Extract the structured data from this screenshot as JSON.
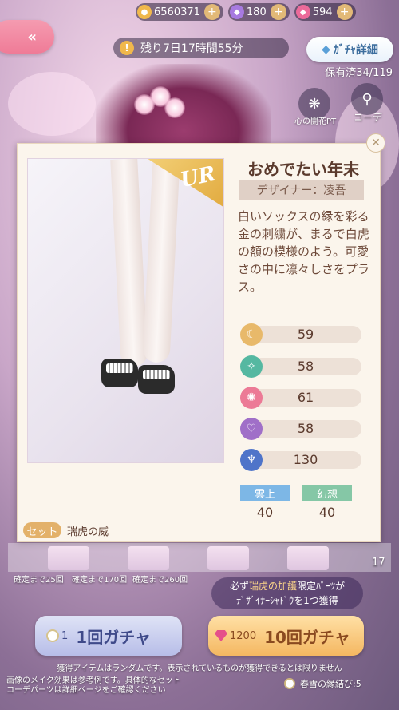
{
  "currencies": [
    {
      "name": "coin-icon",
      "value": "6560371"
    },
    {
      "name": "diamond-icon",
      "value": "180"
    },
    {
      "name": "pink-gem-icon",
      "value": "594"
    }
  ],
  "banner": {
    "timer": "残り7日17時間55分",
    "detail_label": "ｶﾞﾁｬ詳細",
    "owned": "保有済34/119",
    "flower_label": "心の開花PT",
    "coord_label": "コーデ"
  },
  "item": {
    "rarity": "UR",
    "title": "おめでたい年末",
    "designer": "デザイナー：凌吾",
    "description": "白いソックスの縁を彩る金の刺繍が、まるで白虎の額の模様のよう。可愛さの中に凛々しさをプラス。",
    "stats": [
      {
        "icon": "elegant-icon",
        "value": "59",
        "color": "#e8b96a"
      },
      {
        "icon": "fresh-icon",
        "value": "58",
        "color": "#55b8a1"
      },
      {
        "icon": "sweet-icon",
        "value": "61",
        "color": "#ec7a96"
      },
      {
        "icon": "sexy-icon",
        "value": "58",
        "color": "#a06fc8"
      },
      {
        "icon": "cool-icon",
        "value": "130",
        "color": "#4f74c9"
      }
    ],
    "tags": [
      {
        "label": "雲上",
        "value": "40",
        "color": "#7db7e6"
      },
      {
        "label": "幻想",
        "value": "40",
        "color": "#85c7a6"
      }
    ],
    "set_label": "セット",
    "set_name": "瑞虎の威"
  },
  "progress": {
    "counts": [
      "確定まで25回",
      "確定まで170回",
      "確定まで260回"
    ],
    "side_number": "17"
  },
  "guarantee": {
    "prefix": "必ず",
    "highlight": "瑞虎の加護",
    "line1_rest": "限定ﾊﾟｰﾂが",
    "line2": "ﾃﾞｻﾞｲﾅｰｼｬﾄﾞｳを1つ獲得"
  },
  "gacha": {
    "single_cost": "1",
    "single_label": "1回ガチャ",
    "ten_cost": "1200",
    "ten_label": "10回ガチャ"
  },
  "footer": {
    "disclaimer": "獲得アイテムはランダムです。表示されているものが獲得できるとは限りません",
    "note_line1": "画像のメイク効果は参考例です。具体的なセット",
    "note_line2": "コーデパーツは詳細ページをご確認ください",
    "fate": "春雪の縁結び:5"
  }
}
